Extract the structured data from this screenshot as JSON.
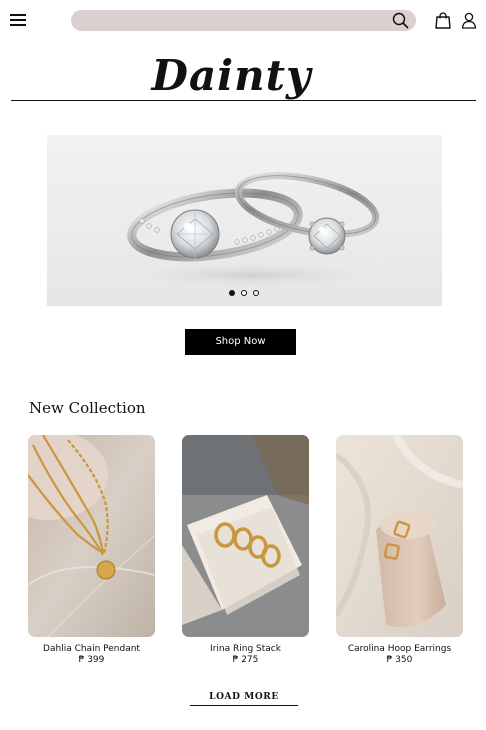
{
  "header": {
    "menu_icon": "hamburger-icon",
    "search": {
      "placeholder": "",
      "value": "",
      "icon": "search-icon"
    },
    "cart_icon": "shopping-bag-icon",
    "account_icon": "user-icon",
    "search_bar_color": "#dccfd0"
  },
  "brand": {
    "logo": "Dainty"
  },
  "hero": {
    "image": "silver diamond rings on white",
    "carousel_dots": 3,
    "active_dot": 0,
    "cta_label": "Shop Now"
  },
  "collection": {
    "title": "New Collection",
    "products": [
      {
        "name": "Dahlia Chain Pendant",
        "price": "₱ 399"
      },
      {
        "name": "Irina Ring Stack",
        "price": "₱ 275"
      },
      {
        "name": "Carolina Hoop Earrings",
        "price": "₱ 350"
      }
    ],
    "load_more_label": "LOAD MORE"
  },
  "colors": {
    "accent": "#000000",
    "search_bg": "#dccfd0",
    "gold": "#c9973f"
  }
}
